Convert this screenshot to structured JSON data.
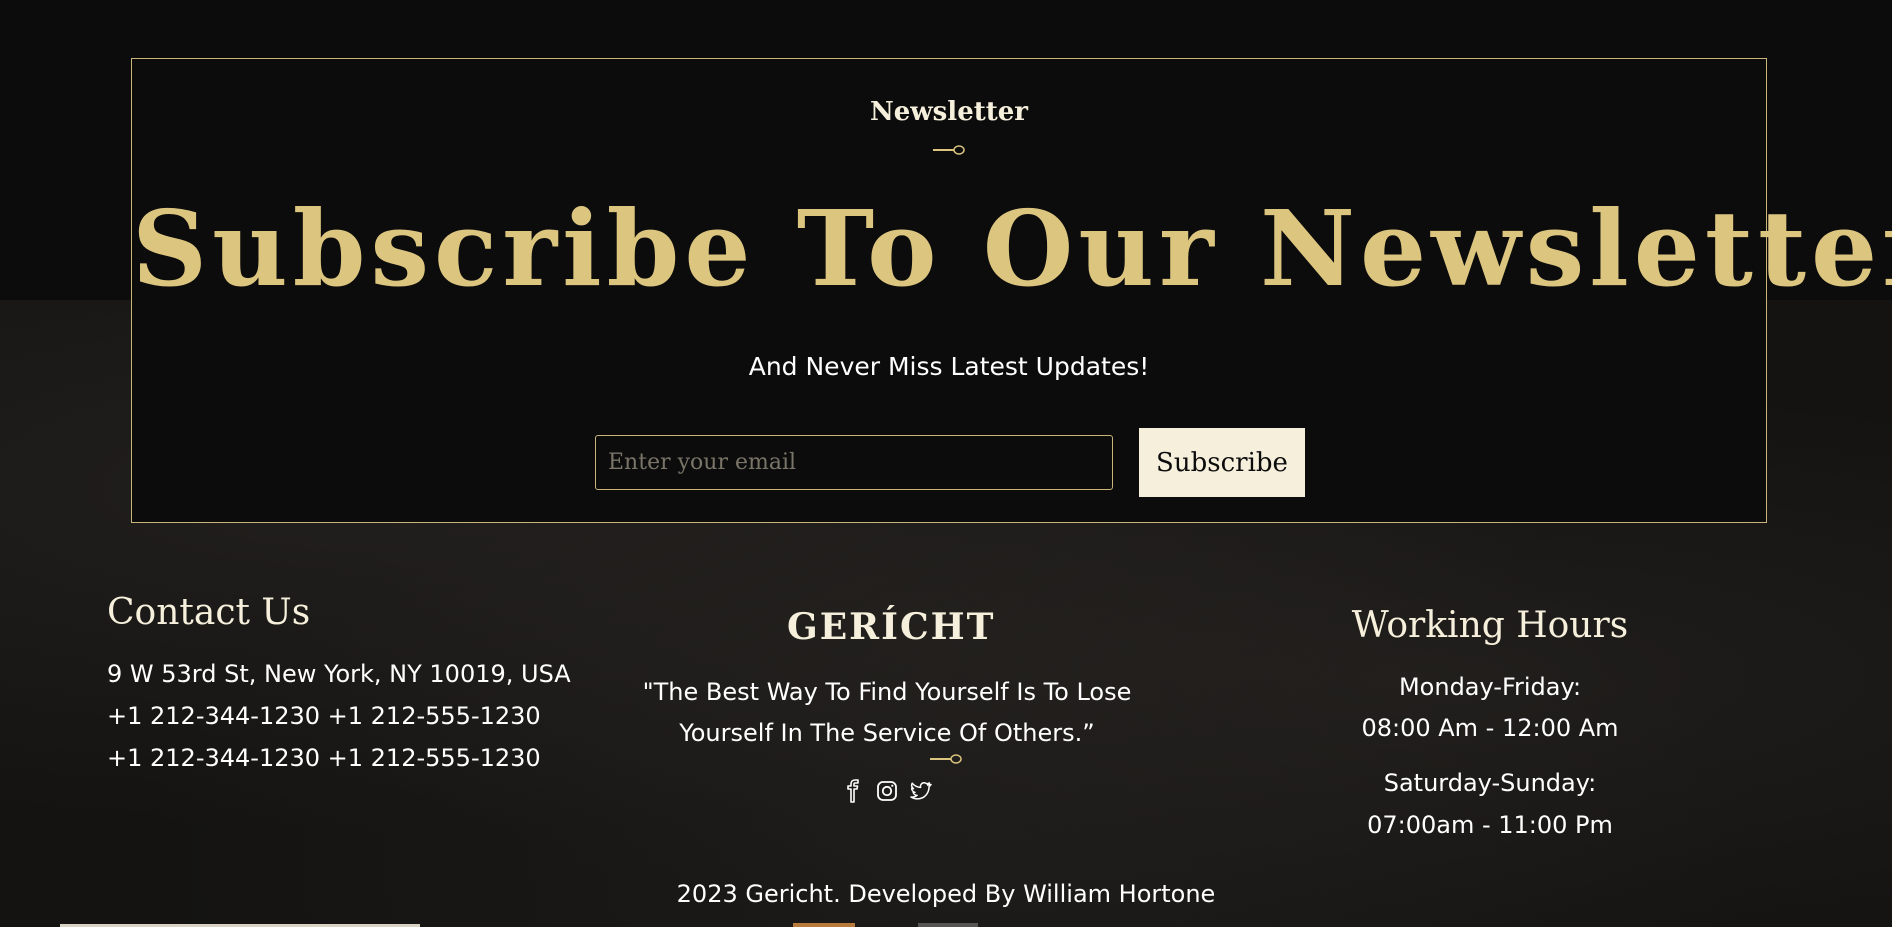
{
  "newsletter": {
    "subtitle": "Newsletter",
    "headline": "Subscribe To Our Newsletter",
    "tagline": "And Never Miss Latest Updates!",
    "email_placeholder": "Enter your email",
    "subscribe_label": "Subscribe"
  },
  "contact": {
    "title": "Contact Us",
    "address": "9 W 53rd St, New York, NY 10019, USA",
    "phone_line_1": "+1 212-344-1230 +1 212-555-1230",
    "phone_line_2": "+1 212-344-1230 +1 212-555-1230"
  },
  "brand": {
    "name": "GERÍCHT",
    "quote_line_1": "\"The Best Way To Find Yourself Is To Lose",
    "quote_line_2": "Yourself In The Service Of Others.”",
    "social_icons": [
      "facebook-icon",
      "instagram-icon",
      "twitter-icon"
    ]
  },
  "hours": {
    "title": "Working Hours",
    "weekday_label": "Monday-Friday:",
    "weekday_time": "08:00 Am - 12:00 Am",
    "weekend_label": "Saturday-Sunday:",
    "weekend_time": "07:00am - 11:00 Pm"
  },
  "footer": {
    "copyright": "2023 Gericht. Developed By William Hortone"
  },
  "colors": {
    "background": "#0c0c0c",
    "gold": "#dcc57e",
    "cream": "#f5efdb",
    "border": "#c9b47a"
  }
}
